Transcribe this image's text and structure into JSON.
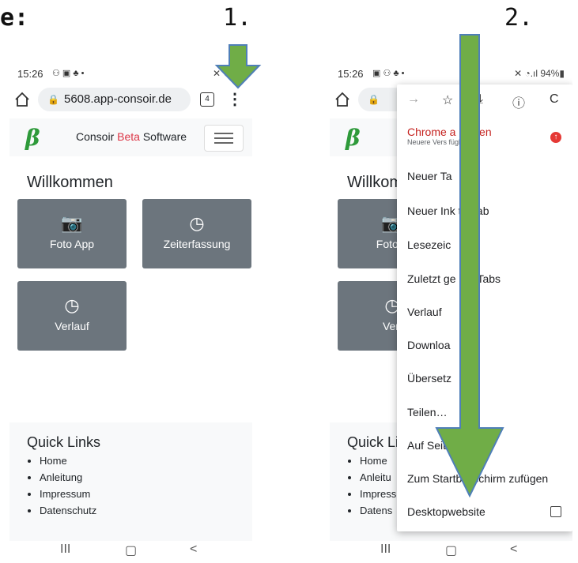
{
  "steps": {
    "left_fragment": "e:",
    "step1": "1.",
    "step2": "2."
  },
  "phone1": {
    "status": {
      "time": "15:26",
      "icons": "⚇ ▣ ♣ •",
      "right": "✕ ◔.ıl 9"
    },
    "url_bar": {
      "url": "5608.app-consoir.de",
      "tab_count": "4"
    },
    "navbar": {
      "logo": "β",
      "brand_prefix": "Consoir ",
      "brand_beta": "Beta",
      "brand_suffix": " Software"
    },
    "page_title": "Willkommen",
    "tiles": [
      {
        "icon": "📷",
        "label": "Foto App"
      },
      {
        "icon": "◷",
        "label": "Zeiterfassung"
      },
      {
        "icon": "◷",
        "label": "Verlauf"
      }
    ],
    "footer": {
      "title": "Quick Links",
      "links": [
        "Home",
        "Anleitung",
        "Impressum",
        "Datenschutz"
      ]
    },
    "system_nav": {
      "recents": "III",
      "home": "▢",
      "back": "<"
    }
  },
  "phone2": {
    "status": {
      "time": "15:26",
      "icons": "▣ ⚇ ♣ •",
      "right": "✕ ◔.ıl 94%▮"
    },
    "behind": {
      "page_title": "Willkom",
      "tile1_label": "Foto A",
      "tile2_label": "Verl",
      "footer_title": "Quick Lin",
      "links": [
        "Home",
        "Anleitu",
        "Impress",
        "Datens"
      ]
    },
    "menu": {
      "icons": {
        "forward": "→",
        "bookmark": "☆",
        "download": "⤓",
        "info": "ⓘ",
        "refresh": "C"
      },
      "update_title": "Chrome a      isieren",
      "update_sub": "Neuere Vers        fügbar",
      "items": [
        "Neuer Ta",
        "Neuer Ink       to-Tab",
        "Lesezeic",
        "Zuletzt ge        ete Tabs",
        "Verlauf",
        "Downloa",
        "Übersetz",
        "Teilen…",
        "Auf Seite       en",
        "Zum Startbildschirm zufügen",
        "Desktopwebsite"
      ]
    },
    "system_nav": {
      "recents": "III",
      "home": "▢",
      "back": "<"
    }
  },
  "colors": {
    "arrow_fill": "#70ad47",
    "arrow_stroke": "#4f7fb8",
    "tile_bg": "#6c757d",
    "logo_green": "#2e9a3a",
    "beta_red": "#dc3545"
  }
}
